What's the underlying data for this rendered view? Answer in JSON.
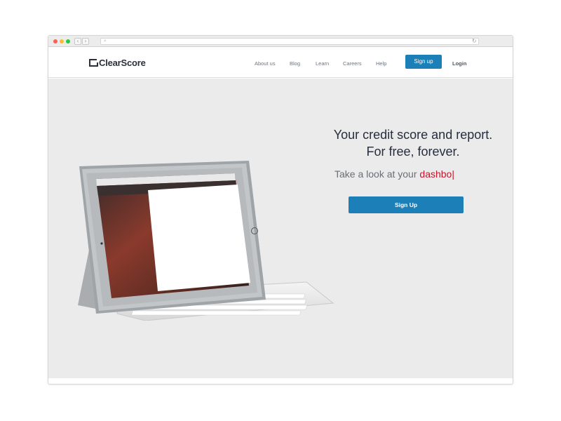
{
  "browser": {
    "controls": {
      "back_symbol": "‹",
      "forward_symbol": "›",
      "search_symbol": "⌕",
      "reload_symbol": "↻"
    }
  },
  "header": {
    "logo_text": "ClearScore",
    "nav": {
      "about": "About us",
      "blog": "Blog",
      "learn": "Learn",
      "careers": "Careers",
      "help": "Help"
    },
    "signup_label": "Sign up",
    "login_label": "Login"
  },
  "hero": {
    "headline_line1": "Your credit score and report.",
    "headline_line2": "For free, forever.",
    "tagline_prefix": "Take a look at your",
    "tagline_typed": "dashbo",
    "caret": "|",
    "signup_label": "Sign Up"
  },
  "colors": {
    "brand_blue": "#1d7fb7",
    "hero_background": "#ebebeb",
    "typed_text_red": "#c4162a",
    "heading_navy": "#262d3c"
  },
  "illustration": {
    "icon": "ipad-keyboard-illustration"
  }
}
